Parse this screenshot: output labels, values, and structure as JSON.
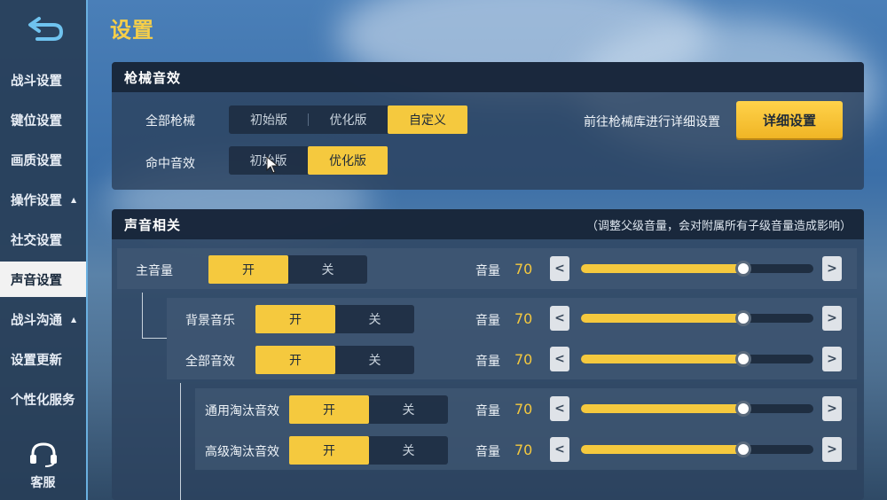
{
  "sidebar": {
    "items": [
      {
        "label": "战斗设置",
        "arrow": false,
        "active": false
      },
      {
        "label": "键位设置",
        "arrow": false,
        "active": false
      },
      {
        "label": "画质设置",
        "arrow": false,
        "active": false
      },
      {
        "label": "操作设置",
        "arrow": true,
        "active": false
      },
      {
        "label": "社交设置",
        "arrow": false,
        "active": false
      },
      {
        "label": "声音设置",
        "arrow": false,
        "active": true
      },
      {
        "label": "战斗沟通",
        "arrow": true,
        "active": false
      },
      {
        "label": "设置更新",
        "arrow": false,
        "active": false
      },
      {
        "label": "个性化服务",
        "arrow": false,
        "active": false
      }
    ],
    "support_label": "客服",
    "arrow_glyph": "▲"
  },
  "page": {
    "title": "设置"
  },
  "gun_panel": {
    "title": "枪械音效",
    "all_guns_label": "全部枪械",
    "all_guns_options": [
      "初始版",
      "优化版",
      "自定义"
    ],
    "all_guns_selected": 2,
    "hit_label": "命中音效",
    "hit_options": [
      "初始版",
      "优化版"
    ],
    "hit_selected": 1,
    "detail_hint": "前往枪械库进行详细设置",
    "detail_button": "详细设置"
  },
  "sound_panel": {
    "title": "声音相关",
    "note": "（调整父级音量，会对附属所有子级音量造成影响）",
    "on_label": "开",
    "off_label": "关",
    "volume_label": "音量",
    "left_arrow": "<",
    "right_arrow": ">",
    "rows": [
      {
        "label": "主音量",
        "on": true,
        "volume": 70
      },
      {
        "label": "背景音乐",
        "on": true,
        "volume": 70
      },
      {
        "label": "全部音效",
        "on": true,
        "volume": 70
      },
      {
        "label": "通用淘汰音效",
        "on": true,
        "volume": 70
      },
      {
        "label": "高级淘汰音效",
        "on": true,
        "volume": 70
      }
    ],
    "max_volume": 100
  },
  "colors": {
    "accent": "#f5c93e",
    "sidebar_border": "#6ab0e0"
  }
}
